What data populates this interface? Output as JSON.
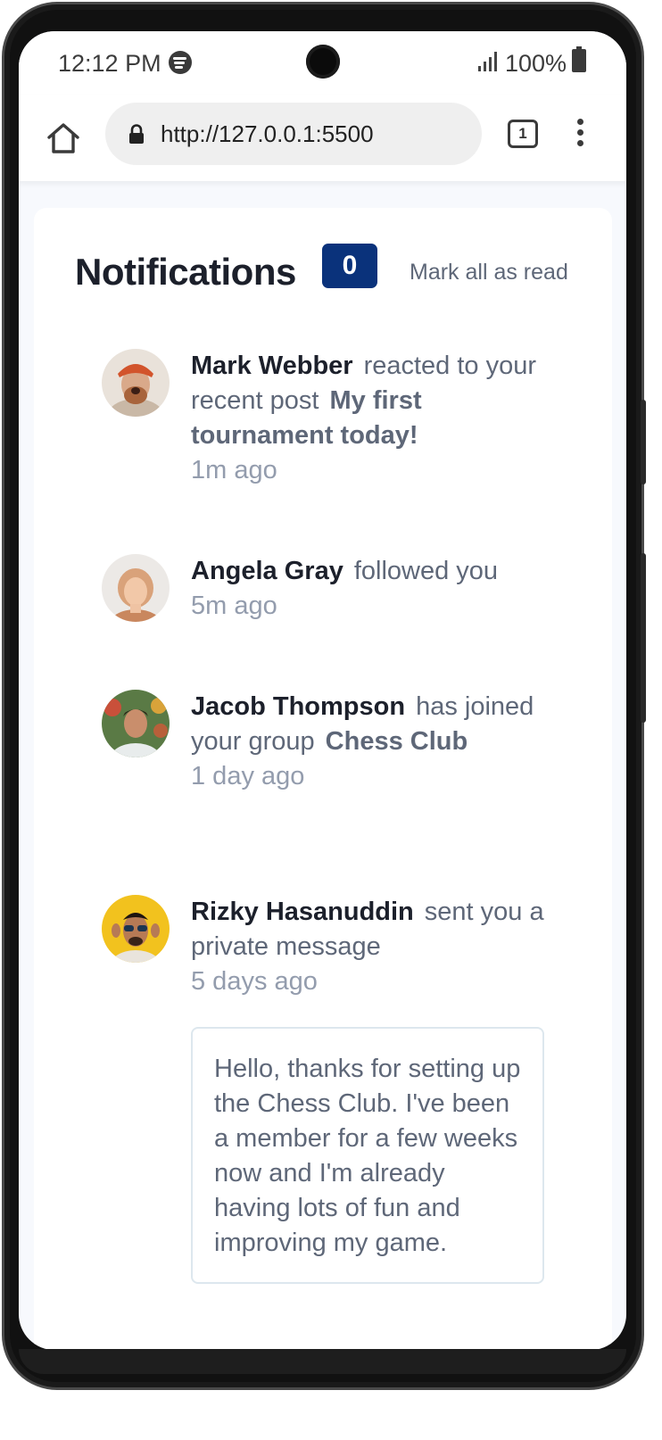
{
  "status_bar": {
    "time": "12:12 PM",
    "battery": "100%",
    "icons": [
      "spotify-icon",
      "signal-icon",
      "battery-icon"
    ]
  },
  "browser": {
    "url": "http://127.0.0.1:5500",
    "tab_count": "1",
    "icons": [
      "home-icon",
      "lock-icon",
      "tabs-icon",
      "menu-icon"
    ]
  },
  "header": {
    "title": "Notifications",
    "unread_count": "0",
    "mark_all_label": "Mark all as read"
  },
  "colors": {
    "badge": "#0a327b",
    "heading": "#1c202b",
    "body_text": "#5e6778",
    "muted_text": "#939cad",
    "card_bg": "#ffffff",
    "page_bg": "#f7f9fd"
  },
  "notifications": [
    {
      "name": "Mark Webber",
      "action": "reacted to your recent post",
      "target": "My first tournament today!",
      "time": "1m ago"
    },
    {
      "name": "Angela Gray",
      "action": "followed you",
      "time": "5m ago"
    },
    {
      "name": "Jacob Thompson",
      "action": "has joined your group",
      "target": "Chess Club",
      "time": "1 day ago"
    },
    {
      "name": "Rizky Hasanuddin",
      "action": "sent you a private message",
      "time": "5 days ago",
      "message": "Hello, thanks for setting up the Chess Club. I've been a member for a few weeks now and I'm already having lots of fun and improving my game."
    }
  ]
}
